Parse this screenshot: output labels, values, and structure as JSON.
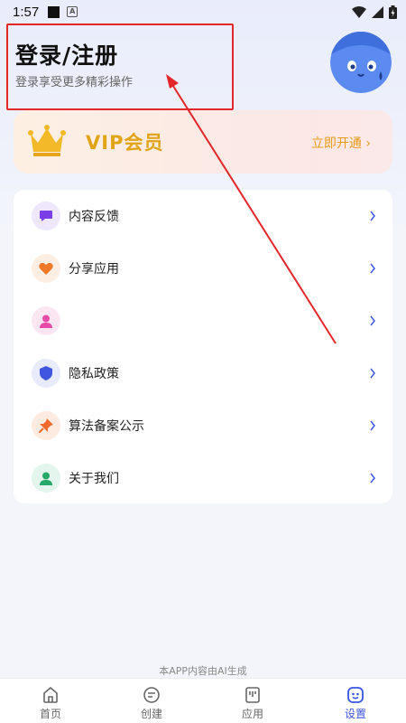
{
  "status_bar": {
    "time": "1:57",
    "a_label": "A"
  },
  "header": {
    "title": "登录/注册",
    "subtitle": "登录享受更多精彩操作"
  },
  "vip": {
    "label": "VIP会员",
    "action": "立即开通 ›"
  },
  "menu": {
    "items": [
      {
        "label": "内容反馈",
        "icon": "chat-icon",
        "color": "#7a3ee8",
        "bg": "#efe8fc"
      },
      {
        "label": "分享应用",
        "icon": "heart-icon",
        "color": "#f07a2a",
        "bg": "#fdeee4"
      },
      {
        "label": "",
        "icon": "person-icon",
        "color": "#e64ba8",
        "bg": "#fbe6f2"
      },
      {
        "label": "隐私政策",
        "icon": "shield-icon",
        "color": "#3f57e0",
        "bg": "#e8ebfb"
      },
      {
        "label": "算法备案公示",
        "icon": "pin-icon",
        "color": "#ef6a2a",
        "bg": "#fdebe2"
      },
      {
        "label": "关于我们",
        "icon": "user-icon",
        "color": "#27a86b",
        "bg": "#e3f5ec"
      }
    ]
  },
  "footer_note": "本APP内容由AI生成",
  "tabbar": {
    "tabs": [
      {
        "label": "首页",
        "icon": "home-icon"
      },
      {
        "label": "创建",
        "icon": "create-icon"
      },
      {
        "label": "应用",
        "icon": "apps-icon"
      },
      {
        "label": "设置",
        "icon": "settings-icon",
        "active": true
      }
    ]
  },
  "colors": {
    "accent": "#3a56e4",
    "vip_gold": "#e1a417",
    "annotation_red": "#e3262a"
  }
}
